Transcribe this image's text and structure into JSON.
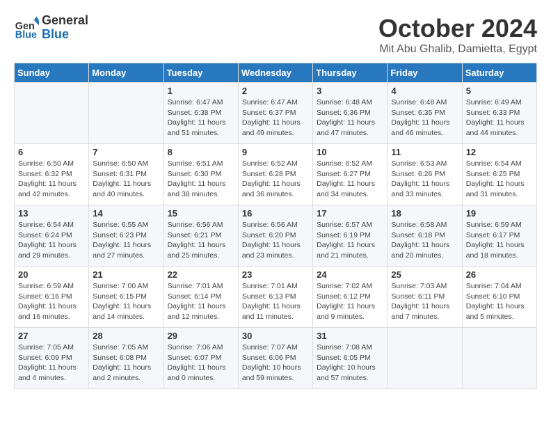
{
  "header": {
    "logo_general": "General",
    "logo_blue": "Blue",
    "month": "October 2024",
    "location": "Mit Abu Ghalib, Damietta, Egypt"
  },
  "days_of_week": [
    "Sunday",
    "Monday",
    "Tuesday",
    "Wednesday",
    "Thursday",
    "Friday",
    "Saturday"
  ],
  "weeks": [
    [
      {
        "day": "",
        "info": ""
      },
      {
        "day": "",
        "info": ""
      },
      {
        "day": "1",
        "info": "Sunrise: 6:47 AM\nSunset: 6:38 PM\nDaylight: 11 hours\nand 51 minutes."
      },
      {
        "day": "2",
        "info": "Sunrise: 6:47 AM\nSunset: 6:37 PM\nDaylight: 11 hours\nand 49 minutes."
      },
      {
        "day": "3",
        "info": "Sunrise: 6:48 AM\nSunset: 6:36 PM\nDaylight: 11 hours\nand 47 minutes."
      },
      {
        "day": "4",
        "info": "Sunrise: 6:48 AM\nSunset: 6:35 PM\nDaylight: 11 hours\nand 46 minutes."
      },
      {
        "day": "5",
        "info": "Sunrise: 6:49 AM\nSunset: 6:33 PM\nDaylight: 11 hours\nand 44 minutes."
      }
    ],
    [
      {
        "day": "6",
        "info": "Sunrise: 6:50 AM\nSunset: 6:32 PM\nDaylight: 11 hours\nand 42 minutes."
      },
      {
        "day": "7",
        "info": "Sunrise: 6:50 AM\nSunset: 6:31 PM\nDaylight: 11 hours\nand 40 minutes."
      },
      {
        "day": "8",
        "info": "Sunrise: 6:51 AM\nSunset: 6:30 PM\nDaylight: 11 hours\nand 38 minutes."
      },
      {
        "day": "9",
        "info": "Sunrise: 6:52 AM\nSunset: 6:28 PM\nDaylight: 11 hours\nand 36 minutes."
      },
      {
        "day": "10",
        "info": "Sunrise: 6:52 AM\nSunset: 6:27 PM\nDaylight: 11 hours\nand 34 minutes."
      },
      {
        "day": "11",
        "info": "Sunrise: 6:53 AM\nSunset: 6:26 PM\nDaylight: 11 hours\nand 33 minutes."
      },
      {
        "day": "12",
        "info": "Sunrise: 6:54 AM\nSunset: 6:25 PM\nDaylight: 11 hours\nand 31 minutes."
      }
    ],
    [
      {
        "day": "13",
        "info": "Sunrise: 6:54 AM\nSunset: 6:24 PM\nDaylight: 11 hours\nand 29 minutes."
      },
      {
        "day": "14",
        "info": "Sunrise: 6:55 AM\nSunset: 6:23 PM\nDaylight: 11 hours\nand 27 minutes."
      },
      {
        "day": "15",
        "info": "Sunrise: 6:56 AM\nSunset: 6:21 PM\nDaylight: 11 hours\nand 25 minutes."
      },
      {
        "day": "16",
        "info": "Sunrise: 6:56 AM\nSunset: 6:20 PM\nDaylight: 11 hours\nand 23 minutes."
      },
      {
        "day": "17",
        "info": "Sunrise: 6:57 AM\nSunset: 6:19 PM\nDaylight: 11 hours\nand 21 minutes."
      },
      {
        "day": "18",
        "info": "Sunrise: 6:58 AM\nSunset: 6:18 PM\nDaylight: 11 hours\nand 20 minutes."
      },
      {
        "day": "19",
        "info": "Sunrise: 6:59 AM\nSunset: 6:17 PM\nDaylight: 11 hours\nand 18 minutes."
      }
    ],
    [
      {
        "day": "20",
        "info": "Sunrise: 6:59 AM\nSunset: 6:16 PM\nDaylight: 11 hours\nand 16 minutes."
      },
      {
        "day": "21",
        "info": "Sunrise: 7:00 AM\nSunset: 6:15 PM\nDaylight: 11 hours\nand 14 minutes."
      },
      {
        "day": "22",
        "info": "Sunrise: 7:01 AM\nSunset: 6:14 PM\nDaylight: 11 hours\nand 12 minutes."
      },
      {
        "day": "23",
        "info": "Sunrise: 7:01 AM\nSunset: 6:13 PM\nDaylight: 11 hours\nand 11 minutes."
      },
      {
        "day": "24",
        "info": "Sunrise: 7:02 AM\nSunset: 6:12 PM\nDaylight: 11 hours\nand 9 minutes."
      },
      {
        "day": "25",
        "info": "Sunrise: 7:03 AM\nSunset: 6:11 PM\nDaylight: 11 hours\nand 7 minutes."
      },
      {
        "day": "26",
        "info": "Sunrise: 7:04 AM\nSunset: 6:10 PM\nDaylight: 11 hours\nand 5 minutes."
      }
    ],
    [
      {
        "day": "27",
        "info": "Sunrise: 7:05 AM\nSunset: 6:09 PM\nDaylight: 11 hours\nand 4 minutes."
      },
      {
        "day": "28",
        "info": "Sunrise: 7:05 AM\nSunset: 6:08 PM\nDaylight: 11 hours\nand 2 minutes."
      },
      {
        "day": "29",
        "info": "Sunrise: 7:06 AM\nSunset: 6:07 PM\nDaylight: 11 hours\nand 0 minutes."
      },
      {
        "day": "30",
        "info": "Sunrise: 7:07 AM\nSunset: 6:06 PM\nDaylight: 10 hours\nand 59 minutes."
      },
      {
        "day": "31",
        "info": "Sunrise: 7:08 AM\nSunset: 6:05 PM\nDaylight: 10 hours\nand 57 minutes."
      },
      {
        "day": "",
        "info": ""
      },
      {
        "day": "",
        "info": ""
      }
    ]
  ]
}
